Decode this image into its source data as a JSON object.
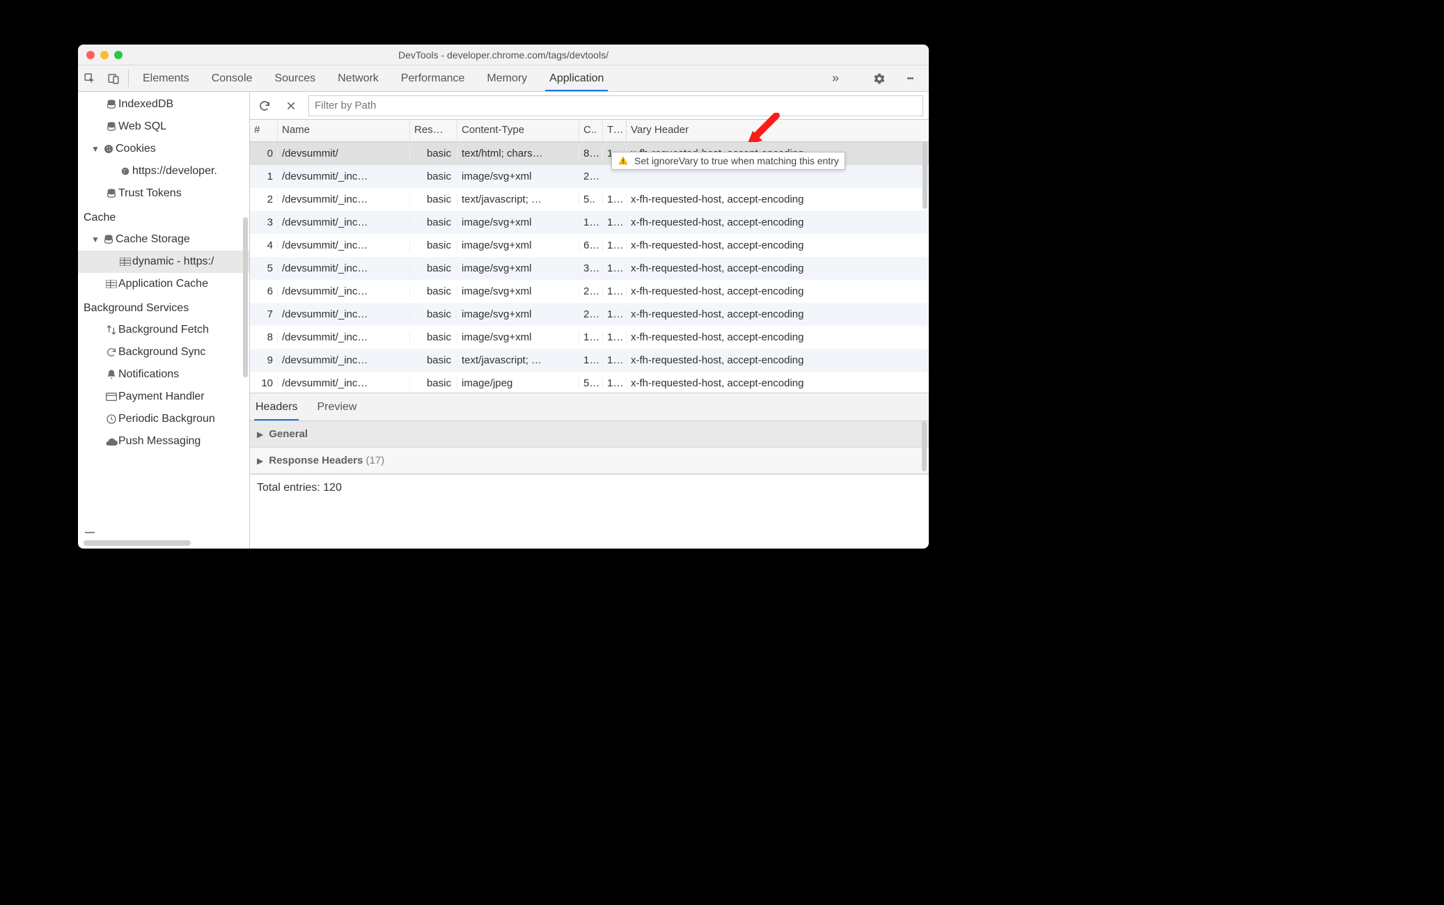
{
  "window": {
    "title": "DevTools - developer.chrome.com/tags/devtools/"
  },
  "panel_tabs": [
    "Elements",
    "Console",
    "Sources",
    "Network",
    "Performance",
    "Memory",
    "Application"
  ],
  "sidebar": {
    "storage": [
      "IndexedDB",
      "Web SQL",
      "Cookies",
      "Trust Tokens"
    ],
    "cookie_origin": "https://developer.",
    "sections": {
      "cache": "Cache",
      "bg": "Background Services"
    },
    "cache": [
      "Cache Storage",
      "Application Cache"
    ],
    "cache_selected": "dynamic - https:/",
    "bg": [
      "Background Fetch",
      "Background Sync",
      "Notifications",
      "Payment Handler",
      "Periodic Backgroun",
      "Push Messaging"
    ]
  },
  "toolbar": {
    "filter_placeholder": "Filter by Path"
  },
  "table": {
    "columns": [
      "#",
      "Name",
      "Res…",
      "Content-Type",
      "C..",
      "Ti…",
      "Vary Header"
    ],
    "rows": [
      {
        "idx": "0",
        "name": "/devsummit/",
        "res": "basic",
        "ct": "text/html; chars…",
        "cl": "8…",
        "tc": "1…",
        "vary": "x-fh-requested-host, accept-encoding",
        "selected": true
      },
      {
        "idx": "1",
        "name": "/devsummit/_inc…",
        "res": "basic",
        "ct": "image/svg+xml",
        "cl": "2…",
        "tc": "",
        "vary": ""
      },
      {
        "idx": "2",
        "name": "/devsummit/_inc…",
        "res": "basic",
        "ct": "text/javascript; …",
        "cl": "5..",
        "tc": "1…",
        "vary": "x-fh-requested-host, accept-encoding"
      },
      {
        "idx": "3",
        "name": "/devsummit/_inc…",
        "res": "basic",
        "ct": "image/svg+xml",
        "cl": "1…",
        "tc": "1…",
        "vary": "x-fh-requested-host, accept-encoding"
      },
      {
        "idx": "4",
        "name": "/devsummit/_inc…",
        "res": "basic",
        "ct": "image/svg+xml",
        "cl": "6…",
        "tc": "1…",
        "vary": "x-fh-requested-host, accept-encoding"
      },
      {
        "idx": "5",
        "name": "/devsummit/_inc…",
        "res": "basic",
        "ct": "image/svg+xml",
        "cl": "3…",
        "tc": "1…",
        "vary": "x-fh-requested-host, accept-encoding"
      },
      {
        "idx": "6",
        "name": "/devsummit/_inc…",
        "res": "basic",
        "ct": "image/svg+xml",
        "cl": "2…",
        "tc": "1…",
        "vary": "x-fh-requested-host, accept-encoding"
      },
      {
        "idx": "7",
        "name": "/devsummit/_inc…",
        "res": "basic",
        "ct": "image/svg+xml",
        "cl": "2…",
        "tc": "1…",
        "vary": "x-fh-requested-host, accept-encoding"
      },
      {
        "idx": "8",
        "name": "/devsummit/_inc…",
        "res": "basic",
        "ct": "image/svg+xml",
        "cl": "1…",
        "tc": "1…",
        "vary": "x-fh-requested-host, accept-encoding"
      },
      {
        "idx": "9",
        "name": "/devsummit/_inc…",
        "res": "basic",
        "ct": "text/javascript; …",
        "cl": "1…",
        "tc": "1…",
        "vary": "x-fh-requested-host, accept-encoding"
      },
      {
        "idx": "10",
        "name": "/devsummit/_inc…",
        "res": "basic",
        "ct": "image/jpeg",
        "cl": "5…",
        "tc": "1…",
        "vary": "x-fh-requested-host, accept-encoding"
      }
    ]
  },
  "tooltip": {
    "text": "Set ignoreVary to true when matching this entry"
  },
  "details": {
    "tabs": [
      "Headers",
      "Preview"
    ],
    "sections": [
      "General",
      "Response Headers "
    ],
    "response_headers_count": "17",
    "total_label": "Total entries: ",
    "total_value": "120"
  }
}
